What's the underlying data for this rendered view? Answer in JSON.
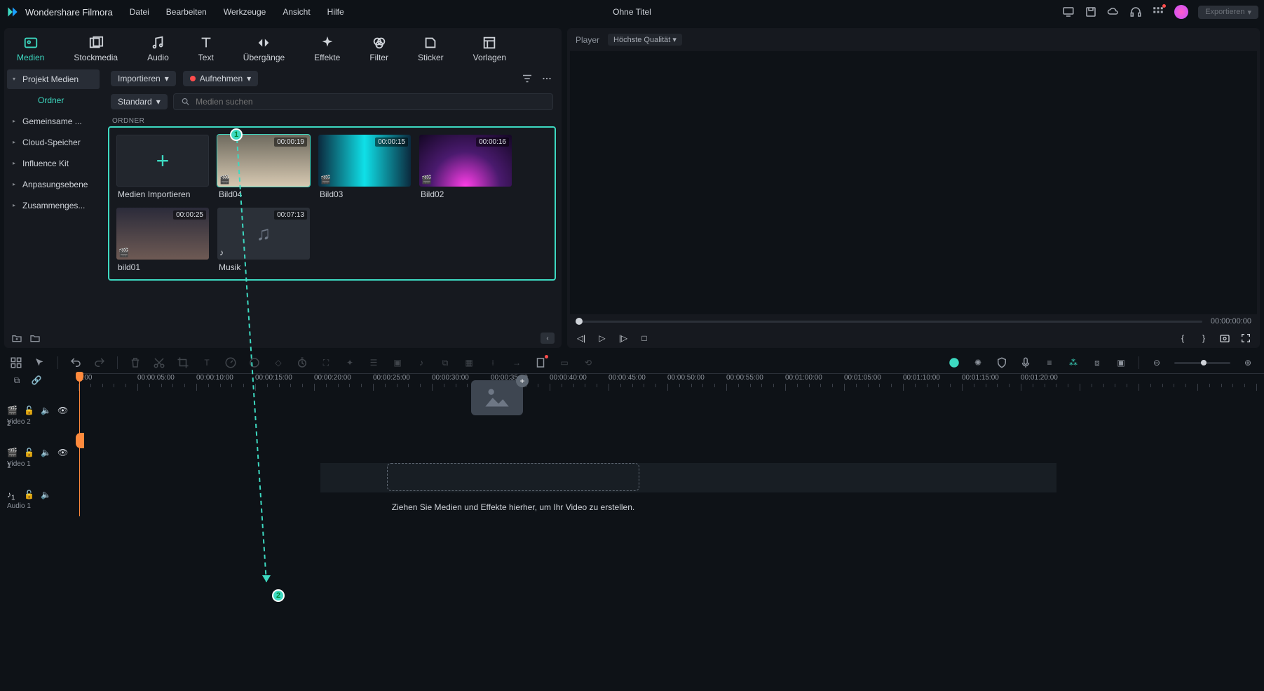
{
  "titlebar": {
    "app_name": "Wondershare Filmora",
    "menus": [
      "Datei",
      "Bearbeiten",
      "Werkzeuge",
      "Ansicht",
      "Hilfe"
    ],
    "doc_title": "Ohne Titel",
    "export_label": "Exportieren"
  },
  "mode_tabs": [
    "Medien",
    "Stockmedia",
    "Audio",
    "Text",
    "Übergänge",
    "Effekte",
    "Filter",
    "Sticker",
    "Vorlagen"
  ],
  "sidebar": {
    "items": [
      {
        "label": "Projekt Medien",
        "active": true
      },
      {
        "label": "Ordner",
        "sub": true
      },
      {
        "label": "Gemeinsame ..."
      },
      {
        "label": "Cloud-Speicher"
      },
      {
        "label": "Influence Kit"
      },
      {
        "label": "Anpasungsebene"
      },
      {
        "label": "Zusammenges..."
      }
    ]
  },
  "actions": {
    "import_label": "Importieren",
    "record_label": "Aufnehmen",
    "filter_label": "Standard",
    "search_placeholder": "Medien suchen"
  },
  "folder_label": "ORDNER",
  "media": [
    {
      "name": "Medien Importieren",
      "kind": "add"
    },
    {
      "name": "Bild04",
      "kind": "video",
      "dur": "00:00:19",
      "bg": "linear-gradient(#6e6a5e,#d7c9b2)",
      "sel": true
    },
    {
      "name": "Bild03",
      "kind": "video",
      "dur": "00:00:15",
      "bg": "linear-gradient(90deg,#0b2a3e,#0fe0e8,#0b2a3e)"
    },
    {
      "name": "Bild02",
      "kind": "video",
      "dur": "00:00:16",
      "bg": "radial-gradient(circle at 50% 100%,#ff3de8,#4a1a6e,#140724)"
    },
    {
      "name": "bild01",
      "kind": "video",
      "dur": "00:00:25",
      "bg": "linear-gradient(#2b2b3a,#6e5a54)"
    },
    {
      "name": "Musik",
      "kind": "audio",
      "dur": "00:07:13",
      "bg": "#2b3038"
    }
  ],
  "player": {
    "label": "Player",
    "quality": "Höchste Qualität",
    "time": "00:00:00:00"
  },
  "ruler": {
    "ticks": [
      "0:00",
      "00:00:05:00",
      "00:00:10:00",
      "00:00:15:00",
      "00:00:20:00",
      "00:00:25:00",
      "00:00:30:00",
      "00:00:35:00",
      "00:00:40:00",
      "00:00:45:00",
      "00:00:50:00",
      "00:00:55:00",
      "00:01:00:00",
      "00:01:05:00",
      "00:01:10:00",
      "00:01:15:00",
      "00:01:20:00"
    ]
  },
  "tracks": [
    {
      "name": "Video 2",
      "count": "2",
      "kind": "video"
    },
    {
      "name": "Video 1",
      "count": "1",
      "kind": "video"
    },
    {
      "name": "Audio 1",
      "count": "1",
      "kind": "audio"
    }
  ],
  "drop_hint": "Ziehen Sie Medien und Effekte hierher, um Ihr Video zu erstellen.",
  "markers": {
    "m1": "1",
    "m2": "2"
  }
}
